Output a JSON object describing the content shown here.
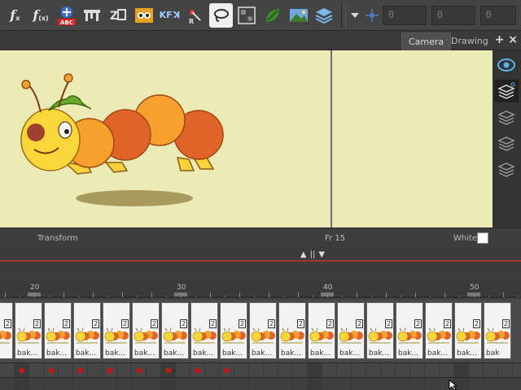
{
  "toolbar": {
    "buttons": [
      {
        "name": "function-icon",
        "label": "f"
      },
      {
        "name": "function-curve-icon",
        "label": "fc"
      },
      {
        "name": "spellcheck-icon",
        "label": "ABC"
      },
      {
        "name": "table-icon",
        "label": ""
      },
      {
        "name": "z-order-icon",
        "label": ""
      },
      {
        "name": "character-icon",
        "label": ""
      },
      {
        "name": "keyframe-icon",
        "label": "KF"
      },
      {
        "name": "reset-icon",
        "label": "R"
      },
      {
        "name": "lasso-icon",
        "label": ""
      },
      {
        "name": "grid-icon",
        "label": ""
      },
      {
        "name": "leaf-icon",
        "label": ""
      },
      {
        "name": "scene-icon",
        "label": ""
      },
      {
        "name": "layers-icon",
        "label": ""
      }
    ],
    "fields": [
      "0",
      "0",
      "0"
    ]
  },
  "tabs": {
    "camera": "Camera",
    "drawing": "Drawing",
    "add": "+",
    "close": "×"
  },
  "status": {
    "tool": "Transform",
    "frame": "Fr 15",
    "bg_label": "White"
  },
  "ruler": {
    "labels": [
      "20",
      "30",
      "40",
      "50"
    ]
  },
  "timeline": {
    "thumbs": [
      {
        "label": "ak",
        "num": "2"
      },
      {
        "label": "bak...",
        "num": "2"
      },
      {
        "label": "bak...",
        "num": "2"
      },
      {
        "label": "bak...",
        "num": "2"
      },
      {
        "label": "bak...",
        "num": "2"
      },
      {
        "label": "bak...",
        "num": "2"
      },
      {
        "label": "bak...",
        "num": "2"
      },
      {
        "label": "bak...",
        "num": "2"
      },
      {
        "label": "bak...",
        "num": "2"
      },
      {
        "label": "bak...",
        "num": "2"
      },
      {
        "label": "bak...",
        "num": "2"
      },
      {
        "label": "bak...",
        "num": "2"
      },
      {
        "label": "bak...",
        "num": "2"
      },
      {
        "label": "bak...",
        "num": "2"
      },
      {
        "label": "bak...",
        "num": "2"
      },
      {
        "label": "bak...",
        "num": "2"
      },
      {
        "label": "bak...",
        "num": "2"
      },
      {
        "label": "bak",
        "num": "2"
      }
    ]
  },
  "colors": {
    "stage_bg": "#ecebb6",
    "keyframe": "#c01818"
  }
}
